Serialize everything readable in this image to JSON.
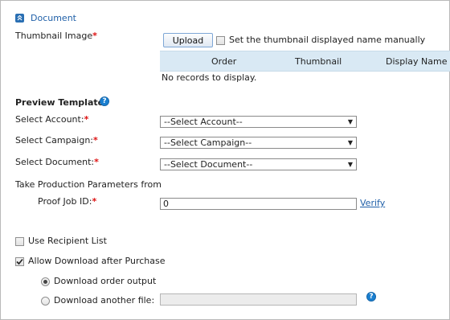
{
  "section": {
    "title": "Document"
  },
  "thumbnail": {
    "label": "Thumbnail Image",
    "required_mark": "*",
    "upload_label": "Upload",
    "manual_name_label": "Set the thumbnail displayed name manually",
    "manual_name_checked": false,
    "columns": [
      "Order",
      "Thumbnail",
      "Display Name"
    ],
    "empty_text": "No records to display."
  },
  "preview": {
    "title": "Preview Template:",
    "help_icon": "help-icon",
    "account_label": "Select Account:",
    "account_value": "--Select Account--",
    "campaign_label": "Select Campaign:",
    "campaign_value": "--Select Campaign--",
    "document_label": "Select Document:",
    "document_value": "--Select Document--",
    "required_mark": "*",
    "production_params_label": "Take Production Parameters from",
    "proof_job_label": "Proof Job ID:",
    "proof_job_value": "0",
    "verify_label": "Verify"
  },
  "options": {
    "use_recipient_list_label": "Use Recipient List",
    "use_recipient_list_checked": false,
    "allow_download_label": "Allow Download after Purchase",
    "allow_download_checked": true,
    "download_order_output_label": "Download order output",
    "download_order_output_selected": true,
    "download_another_file_label": "Download another file:",
    "download_another_file_selected": false,
    "another_file_value": ""
  },
  "colors": {
    "accent": "#1f5fa8",
    "required": "#dd1111",
    "grid_header": "#d9e9f4"
  }
}
